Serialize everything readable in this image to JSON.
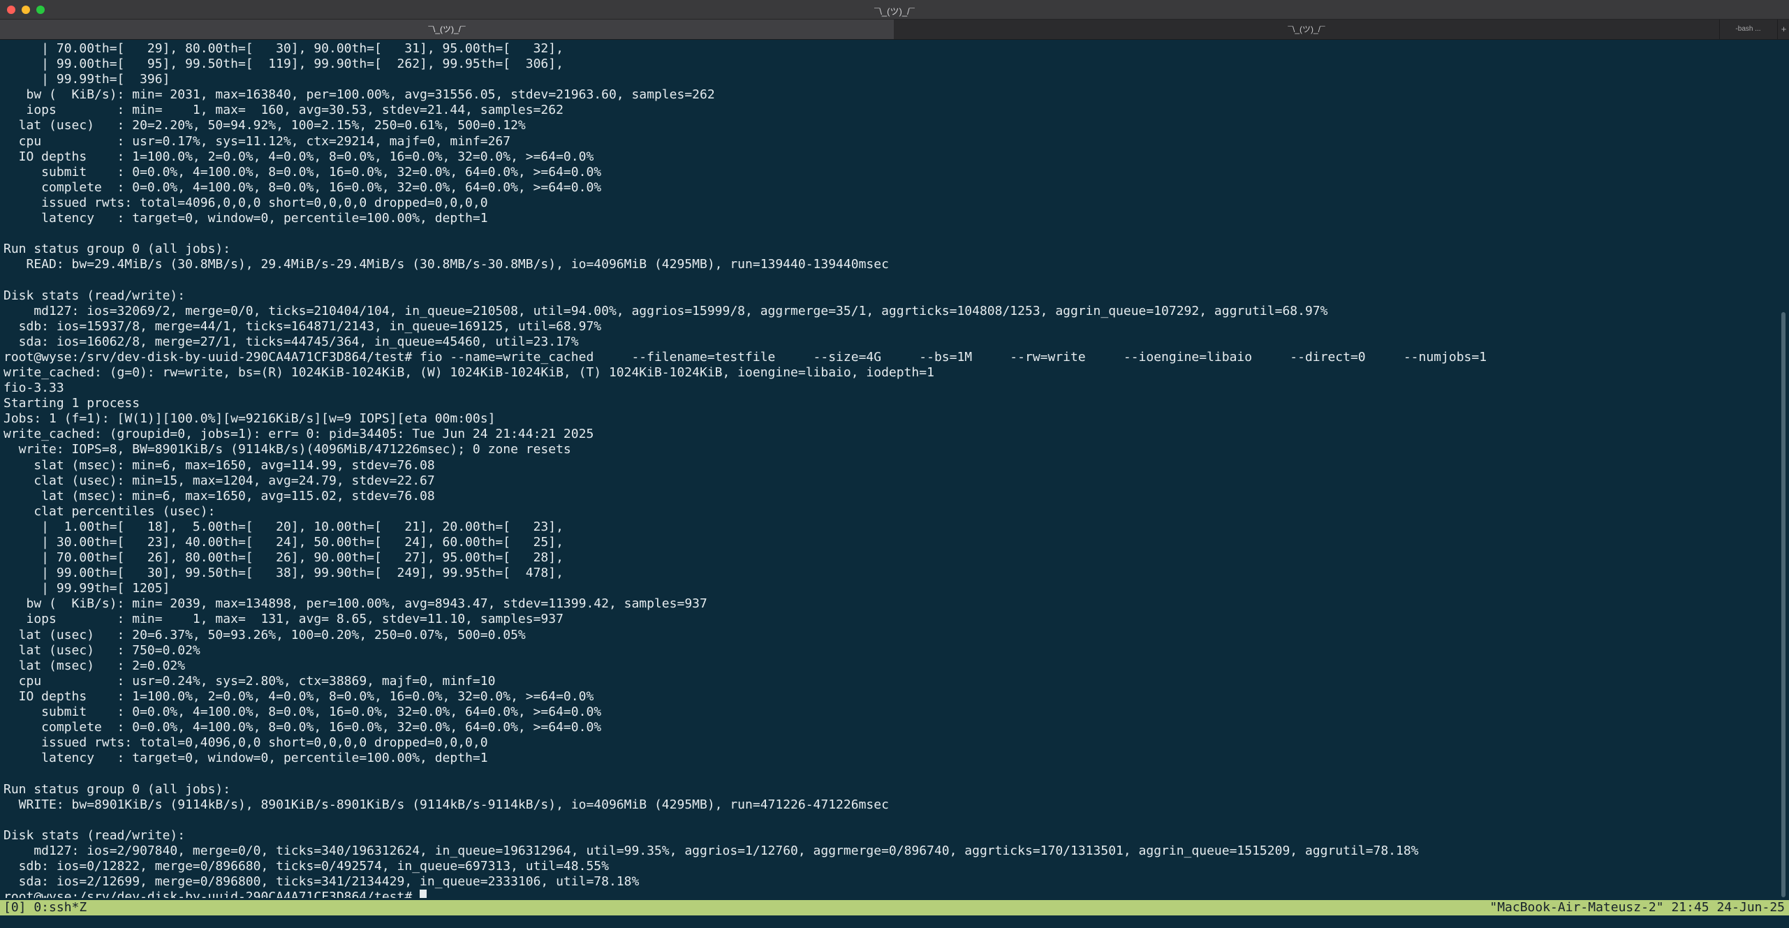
{
  "window": {
    "title": "¯\\_(ツ)_/¯"
  },
  "tabs": [
    {
      "label": "¯\\_(ツ)_/¯"
    },
    {
      "label": "¯\\_(ツ)_/¯"
    },
    {
      "label": "-bash ..."
    }
  ],
  "tab_add_label": "+",
  "terminal": {
    "lines": [
      "     | 70.00th=[   29], 80.00th=[   30], 90.00th=[   31], 95.00th=[   32],",
      "     | 99.00th=[   95], 99.50th=[  119], 99.90th=[  262], 99.95th=[  306],",
      "     | 99.99th=[  396]",
      "   bw (  KiB/s): min= 2031, max=163840, per=100.00%, avg=31556.05, stdev=21963.60, samples=262",
      "   iops        : min=    1, max=  160, avg=30.53, stdev=21.44, samples=262",
      "  lat (usec)   : 20=2.20%, 50=94.92%, 100=2.15%, 250=0.61%, 500=0.12%",
      "  cpu          : usr=0.17%, sys=11.12%, ctx=29214, majf=0, minf=267",
      "  IO depths    : 1=100.0%, 2=0.0%, 4=0.0%, 8=0.0%, 16=0.0%, 32=0.0%, >=64=0.0%",
      "     submit    : 0=0.0%, 4=100.0%, 8=0.0%, 16=0.0%, 32=0.0%, 64=0.0%, >=64=0.0%",
      "     complete  : 0=0.0%, 4=100.0%, 8=0.0%, 16=0.0%, 32=0.0%, 64=0.0%, >=64=0.0%",
      "     issued rwts: total=4096,0,0,0 short=0,0,0,0 dropped=0,0,0,0",
      "     latency   : target=0, window=0, percentile=100.00%, depth=1",
      "",
      "Run status group 0 (all jobs):",
      "   READ: bw=29.4MiB/s (30.8MB/s), 29.4MiB/s-29.4MiB/s (30.8MB/s-30.8MB/s), io=4096MiB (4295MB), run=139440-139440msec",
      "",
      "Disk stats (read/write):",
      "    md127: ios=32069/2, merge=0/0, ticks=210404/104, in_queue=210508, util=94.00%, aggrios=15999/8, aggrmerge=35/1, aggrticks=104808/1253, aggrin_queue=107292, aggrutil=68.97%",
      "  sdb: ios=15937/8, merge=44/1, ticks=164871/2143, in_queue=169125, util=68.97%",
      "  sda: ios=16062/8, merge=27/1, ticks=44745/364, in_queue=45460, util=23.17%",
      "root@wyse:/srv/dev-disk-by-uuid-290CA4A71CF3D864/test# fio --name=write_cached     --filename=testfile     --size=4G     --bs=1M     --rw=write     --ioengine=libaio     --direct=0     --numjobs=1",
      "write_cached: (g=0): rw=write, bs=(R) 1024KiB-1024KiB, (W) 1024KiB-1024KiB, (T) 1024KiB-1024KiB, ioengine=libaio, iodepth=1",
      "fio-3.33",
      "Starting 1 process",
      "Jobs: 1 (f=1): [W(1)][100.0%][w=9216KiB/s][w=9 IOPS][eta 00m:00s]",
      "write_cached: (groupid=0, jobs=1): err= 0: pid=34405: Tue Jun 24 21:44:21 2025",
      "  write: IOPS=8, BW=8901KiB/s (9114kB/s)(4096MiB/471226msec); 0 zone resets",
      "    slat (msec): min=6, max=1650, avg=114.99, stdev=76.08",
      "    clat (usec): min=15, max=1204, avg=24.79, stdev=22.67",
      "     lat (msec): min=6, max=1650, avg=115.02, stdev=76.08",
      "    clat percentiles (usec):",
      "     |  1.00th=[   18],  5.00th=[   20], 10.00th=[   21], 20.00th=[   23],",
      "     | 30.00th=[   23], 40.00th=[   24], 50.00th=[   24], 60.00th=[   25],",
      "     | 70.00th=[   26], 80.00th=[   26], 90.00th=[   27], 95.00th=[   28],",
      "     | 99.00th=[   30], 99.50th=[   38], 99.90th=[  249], 99.95th=[  478],",
      "     | 99.99th=[ 1205]",
      "   bw (  KiB/s): min= 2039, max=134898, per=100.00%, avg=8943.47, stdev=11399.42, samples=937",
      "   iops        : min=    1, max=  131, avg= 8.65, stdev=11.10, samples=937",
      "  lat (usec)   : 20=6.37%, 50=93.26%, 100=0.20%, 250=0.07%, 500=0.05%",
      "  lat (usec)   : 750=0.02%",
      "  lat (msec)   : 2=0.02%",
      "  cpu          : usr=0.24%, sys=2.80%, ctx=38869, majf=0, minf=10",
      "  IO depths    : 1=100.0%, 2=0.0%, 4=0.0%, 8=0.0%, 16=0.0%, 32=0.0%, >=64=0.0%",
      "     submit    : 0=0.0%, 4=100.0%, 8=0.0%, 16=0.0%, 32=0.0%, 64=0.0%, >=64=0.0%",
      "     complete  : 0=0.0%, 4=100.0%, 8=0.0%, 16=0.0%, 32=0.0%, 64=0.0%, >=64=0.0%",
      "     issued rwts: total=0,4096,0,0 short=0,0,0,0 dropped=0,0,0,0",
      "     latency   : target=0, window=0, percentile=100.00%, depth=1",
      "",
      "Run status group 0 (all jobs):",
      "  WRITE: bw=8901KiB/s (9114kB/s), 8901KiB/s-8901KiB/s (9114kB/s-9114kB/s), io=4096MiB (4295MB), run=471226-471226msec",
      "",
      "Disk stats (read/write):",
      "    md127: ios=2/907840, merge=0/0, ticks=340/196312624, in_queue=196312964, util=99.35%, aggrios=1/12760, aggrmerge=0/896740, aggrticks=170/1313501, aggrin_queue=1515209, aggrutil=78.18%",
      "  sdb: ios=0/12822, merge=0/896680, ticks=0/492574, in_queue=697313, util=48.55%",
      "  sda: ios=2/12699, merge=0/896800, ticks=341/2134429, in_queue=2333106, util=78.18%"
    ],
    "prompt": "root@wyse:/srv/dev-disk-by-uuid-290CA4A71CF3D864/test# "
  },
  "status": {
    "left": "[0] 0:ssh*Z",
    "right": "\"MacBook-Air-Mateusz-2\" 21:45 24-Jun-25"
  },
  "colors": {
    "background": "#0c2b3b",
    "foreground": "#e6ecef",
    "status_bar": "#b5cf7a"
  }
}
